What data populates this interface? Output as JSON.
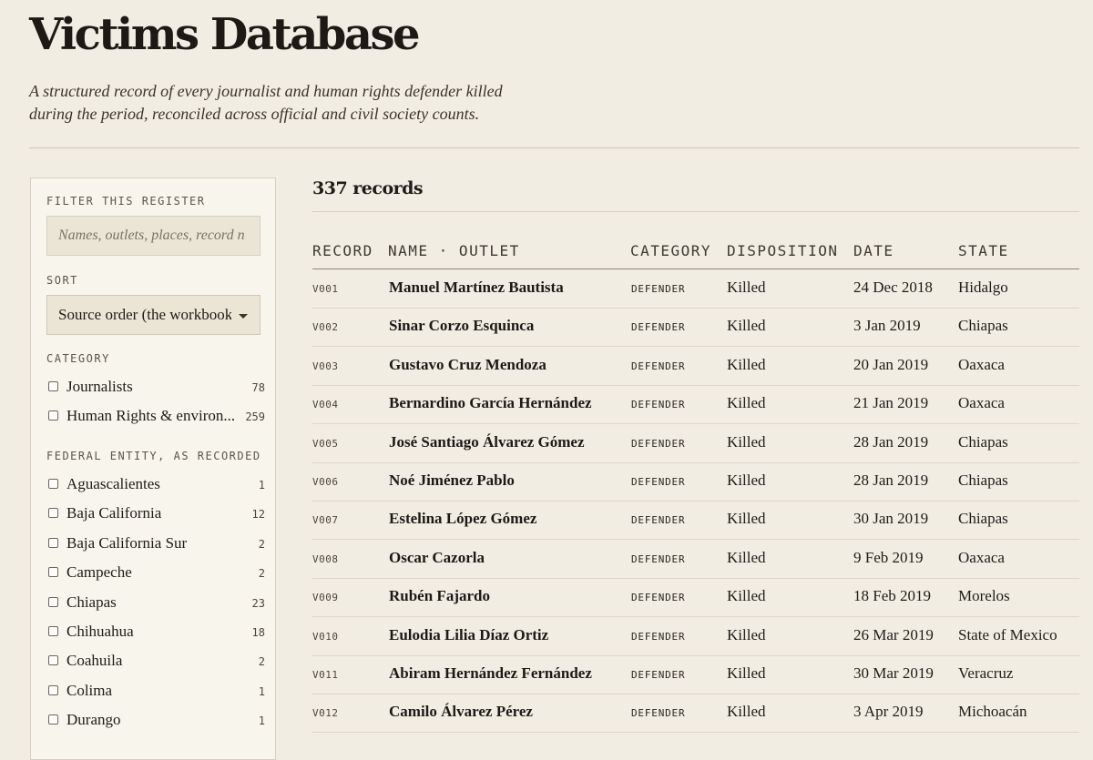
{
  "page": {
    "title": "Victims Database",
    "subtitle": "A structured record of every journalist and human rights defender killed during the period, reconciled across official and civil society counts."
  },
  "sidebar": {
    "filter_heading": "FILTER THIS REGISTER",
    "search_placeholder": "Names, outlets, places, record n",
    "sort_heading": "SORT",
    "sort_value": "Source order (the workbook)",
    "category_heading": "CATEGORY",
    "categories": [
      {
        "label": "Journalists",
        "count": "78"
      },
      {
        "label": "Human Rights & environ...",
        "count": "259"
      }
    ],
    "entity_heading": "FEDERAL ENTITY, AS RECORDED",
    "entities": [
      {
        "label": "Aguascalientes",
        "count": "1"
      },
      {
        "label": "Baja California",
        "count": "12"
      },
      {
        "label": "Baja California Sur",
        "count": "2"
      },
      {
        "label": "Campeche",
        "count": "2"
      },
      {
        "label": "Chiapas",
        "count": "23"
      },
      {
        "label": "Chihuahua",
        "count": "18"
      },
      {
        "label": "Coahuila",
        "count": "2"
      },
      {
        "label": "Colima",
        "count": "1"
      },
      {
        "label": "Durango",
        "count": "1"
      }
    ]
  },
  "table": {
    "record_count": "337 records",
    "headers": {
      "record": "RECORD",
      "name": "NAME · OUTLET",
      "category": "CATEGORY",
      "disposition": "DISPOSITION",
      "date": "DATE",
      "state": "STATE"
    },
    "rows": [
      {
        "id": "V001",
        "name": "Manuel Martínez Bautista",
        "category": "DEFENDER",
        "disposition": "Killed",
        "date": "24 Dec 2018",
        "state": "Hidalgo"
      },
      {
        "id": "V002",
        "name": "Sinar Corzo Esquinca",
        "category": "DEFENDER",
        "disposition": "Killed",
        "date": "3 Jan 2019",
        "state": "Chiapas"
      },
      {
        "id": "V003",
        "name": "Gustavo Cruz Mendoza",
        "category": "DEFENDER",
        "disposition": "Killed",
        "date": "20 Jan 2019",
        "state": "Oaxaca"
      },
      {
        "id": "V004",
        "name": "Bernardino García Hernández",
        "category": "DEFENDER",
        "disposition": "Killed",
        "date": "21 Jan 2019",
        "state": "Oaxaca"
      },
      {
        "id": "V005",
        "name": "José Santiago Álvarez Gómez",
        "category": "DEFENDER",
        "disposition": "Killed",
        "date": "28 Jan 2019",
        "state": "Chiapas"
      },
      {
        "id": "V006",
        "name": "Noé Jiménez Pablo",
        "category": "DEFENDER",
        "disposition": "Killed",
        "date": "28 Jan 2019",
        "state": "Chiapas"
      },
      {
        "id": "V007",
        "name": "Estelina López Gómez",
        "category": "DEFENDER",
        "disposition": "Killed",
        "date": "30 Jan 2019",
        "state": "Chiapas"
      },
      {
        "id": "V008",
        "name": "Oscar Cazorla",
        "category": "DEFENDER",
        "disposition": "Killed",
        "date": "9 Feb 2019",
        "state": "Oaxaca"
      },
      {
        "id": "V009",
        "name": "Rubén Fajardo",
        "category": "DEFENDER",
        "disposition": "Killed",
        "date": "18 Feb 2019",
        "state": "Morelos"
      },
      {
        "id": "V010",
        "name": "Eulodia Lilia Díaz Ortiz",
        "category": "DEFENDER",
        "disposition": "Killed",
        "date": "26 Mar 2019",
        "state": "State of Mexico"
      },
      {
        "id": "V011",
        "name": "Abiram Hernández Fernández",
        "category": "DEFENDER",
        "disposition": "Killed",
        "date": "30 Mar 2019",
        "state": "Veracruz"
      },
      {
        "id": "V012",
        "name": "Camilo Álvarez Pérez",
        "category": "DEFENDER",
        "disposition": "Killed",
        "date": "3 Apr 2019",
        "state": "Michoacán"
      }
    ]
  }
}
